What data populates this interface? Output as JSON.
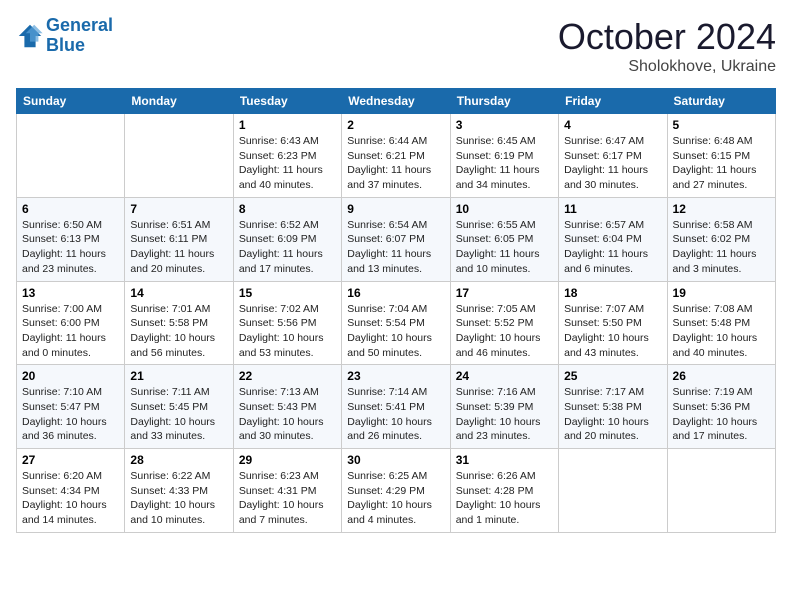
{
  "logo": {
    "line1": "General",
    "line2": "Blue"
  },
  "title": "October 2024",
  "location": "Sholokhove, Ukraine",
  "days_header": [
    "Sunday",
    "Monday",
    "Tuesday",
    "Wednesday",
    "Thursday",
    "Friday",
    "Saturday"
  ],
  "weeks": [
    [
      {
        "day": "",
        "sunrise": "",
        "sunset": "",
        "daylight": ""
      },
      {
        "day": "",
        "sunrise": "",
        "sunset": "",
        "daylight": ""
      },
      {
        "day": "1",
        "sunrise": "Sunrise: 6:43 AM",
        "sunset": "Sunset: 6:23 PM",
        "daylight": "Daylight: 11 hours and 40 minutes."
      },
      {
        "day": "2",
        "sunrise": "Sunrise: 6:44 AM",
        "sunset": "Sunset: 6:21 PM",
        "daylight": "Daylight: 11 hours and 37 minutes."
      },
      {
        "day": "3",
        "sunrise": "Sunrise: 6:45 AM",
        "sunset": "Sunset: 6:19 PM",
        "daylight": "Daylight: 11 hours and 34 minutes."
      },
      {
        "day": "4",
        "sunrise": "Sunrise: 6:47 AM",
        "sunset": "Sunset: 6:17 PM",
        "daylight": "Daylight: 11 hours and 30 minutes."
      },
      {
        "day": "5",
        "sunrise": "Sunrise: 6:48 AM",
        "sunset": "Sunset: 6:15 PM",
        "daylight": "Daylight: 11 hours and 27 minutes."
      }
    ],
    [
      {
        "day": "6",
        "sunrise": "Sunrise: 6:50 AM",
        "sunset": "Sunset: 6:13 PM",
        "daylight": "Daylight: 11 hours and 23 minutes."
      },
      {
        "day": "7",
        "sunrise": "Sunrise: 6:51 AM",
        "sunset": "Sunset: 6:11 PM",
        "daylight": "Daylight: 11 hours and 20 minutes."
      },
      {
        "day": "8",
        "sunrise": "Sunrise: 6:52 AM",
        "sunset": "Sunset: 6:09 PM",
        "daylight": "Daylight: 11 hours and 17 minutes."
      },
      {
        "day": "9",
        "sunrise": "Sunrise: 6:54 AM",
        "sunset": "Sunset: 6:07 PM",
        "daylight": "Daylight: 11 hours and 13 minutes."
      },
      {
        "day": "10",
        "sunrise": "Sunrise: 6:55 AM",
        "sunset": "Sunset: 6:05 PM",
        "daylight": "Daylight: 11 hours and 10 minutes."
      },
      {
        "day": "11",
        "sunrise": "Sunrise: 6:57 AM",
        "sunset": "Sunset: 6:04 PM",
        "daylight": "Daylight: 11 hours and 6 minutes."
      },
      {
        "day": "12",
        "sunrise": "Sunrise: 6:58 AM",
        "sunset": "Sunset: 6:02 PM",
        "daylight": "Daylight: 11 hours and 3 minutes."
      }
    ],
    [
      {
        "day": "13",
        "sunrise": "Sunrise: 7:00 AM",
        "sunset": "Sunset: 6:00 PM",
        "daylight": "Daylight: 11 hours and 0 minutes."
      },
      {
        "day": "14",
        "sunrise": "Sunrise: 7:01 AM",
        "sunset": "Sunset: 5:58 PM",
        "daylight": "Daylight: 10 hours and 56 minutes."
      },
      {
        "day": "15",
        "sunrise": "Sunrise: 7:02 AM",
        "sunset": "Sunset: 5:56 PM",
        "daylight": "Daylight: 10 hours and 53 minutes."
      },
      {
        "day": "16",
        "sunrise": "Sunrise: 7:04 AM",
        "sunset": "Sunset: 5:54 PM",
        "daylight": "Daylight: 10 hours and 50 minutes."
      },
      {
        "day": "17",
        "sunrise": "Sunrise: 7:05 AM",
        "sunset": "Sunset: 5:52 PM",
        "daylight": "Daylight: 10 hours and 46 minutes."
      },
      {
        "day": "18",
        "sunrise": "Sunrise: 7:07 AM",
        "sunset": "Sunset: 5:50 PM",
        "daylight": "Daylight: 10 hours and 43 minutes."
      },
      {
        "day": "19",
        "sunrise": "Sunrise: 7:08 AM",
        "sunset": "Sunset: 5:48 PM",
        "daylight": "Daylight: 10 hours and 40 minutes."
      }
    ],
    [
      {
        "day": "20",
        "sunrise": "Sunrise: 7:10 AM",
        "sunset": "Sunset: 5:47 PM",
        "daylight": "Daylight: 10 hours and 36 minutes."
      },
      {
        "day": "21",
        "sunrise": "Sunrise: 7:11 AM",
        "sunset": "Sunset: 5:45 PM",
        "daylight": "Daylight: 10 hours and 33 minutes."
      },
      {
        "day": "22",
        "sunrise": "Sunrise: 7:13 AM",
        "sunset": "Sunset: 5:43 PM",
        "daylight": "Daylight: 10 hours and 30 minutes."
      },
      {
        "day": "23",
        "sunrise": "Sunrise: 7:14 AM",
        "sunset": "Sunset: 5:41 PM",
        "daylight": "Daylight: 10 hours and 26 minutes."
      },
      {
        "day": "24",
        "sunrise": "Sunrise: 7:16 AM",
        "sunset": "Sunset: 5:39 PM",
        "daylight": "Daylight: 10 hours and 23 minutes."
      },
      {
        "day": "25",
        "sunrise": "Sunrise: 7:17 AM",
        "sunset": "Sunset: 5:38 PM",
        "daylight": "Daylight: 10 hours and 20 minutes."
      },
      {
        "day": "26",
        "sunrise": "Sunrise: 7:19 AM",
        "sunset": "Sunset: 5:36 PM",
        "daylight": "Daylight: 10 hours and 17 minutes."
      }
    ],
    [
      {
        "day": "27",
        "sunrise": "Sunrise: 6:20 AM",
        "sunset": "Sunset: 4:34 PM",
        "daylight": "Daylight: 10 hours and 14 minutes."
      },
      {
        "day": "28",
        "sunrise": "Sunrise: 6:22 AM",
        "sunset": "Sunset: 4:33 PM",
        "daylight": "Daylight: 10 hours and 10 minutes."
      },
      {
        "day": "29",
        "sunrise": "Sunrise: 6:23 AM",
        "sunset": "Sunset: 4:31 PM",
        "daylight": "Daylight: 10 hours and 7 minutes."
      },
      {
        "day": "30",
        "sunrise": "Sunrise: 6:25 AM",
        "sunset": "Sunset: 4:29 PM",
        "daylight": "Daylight: 10 hours and 4 minutes."
      },
      {
        "day": "31",
        "sunrise": "Sunrise: 6:26 AM",
        "sunset": "Sunset: 4:28 PM",
        "daylight": "Daylight: 10 hours and 1 minute."
      },
      {
        "day": "",
        "sunrise": "",
        "sunset": "",
        "daylight": ""
      },
      {
        "day": "",
        "sunrise": "",
        "sunset": "",
        "daylight": ""
      }
    ]
  ]
}
